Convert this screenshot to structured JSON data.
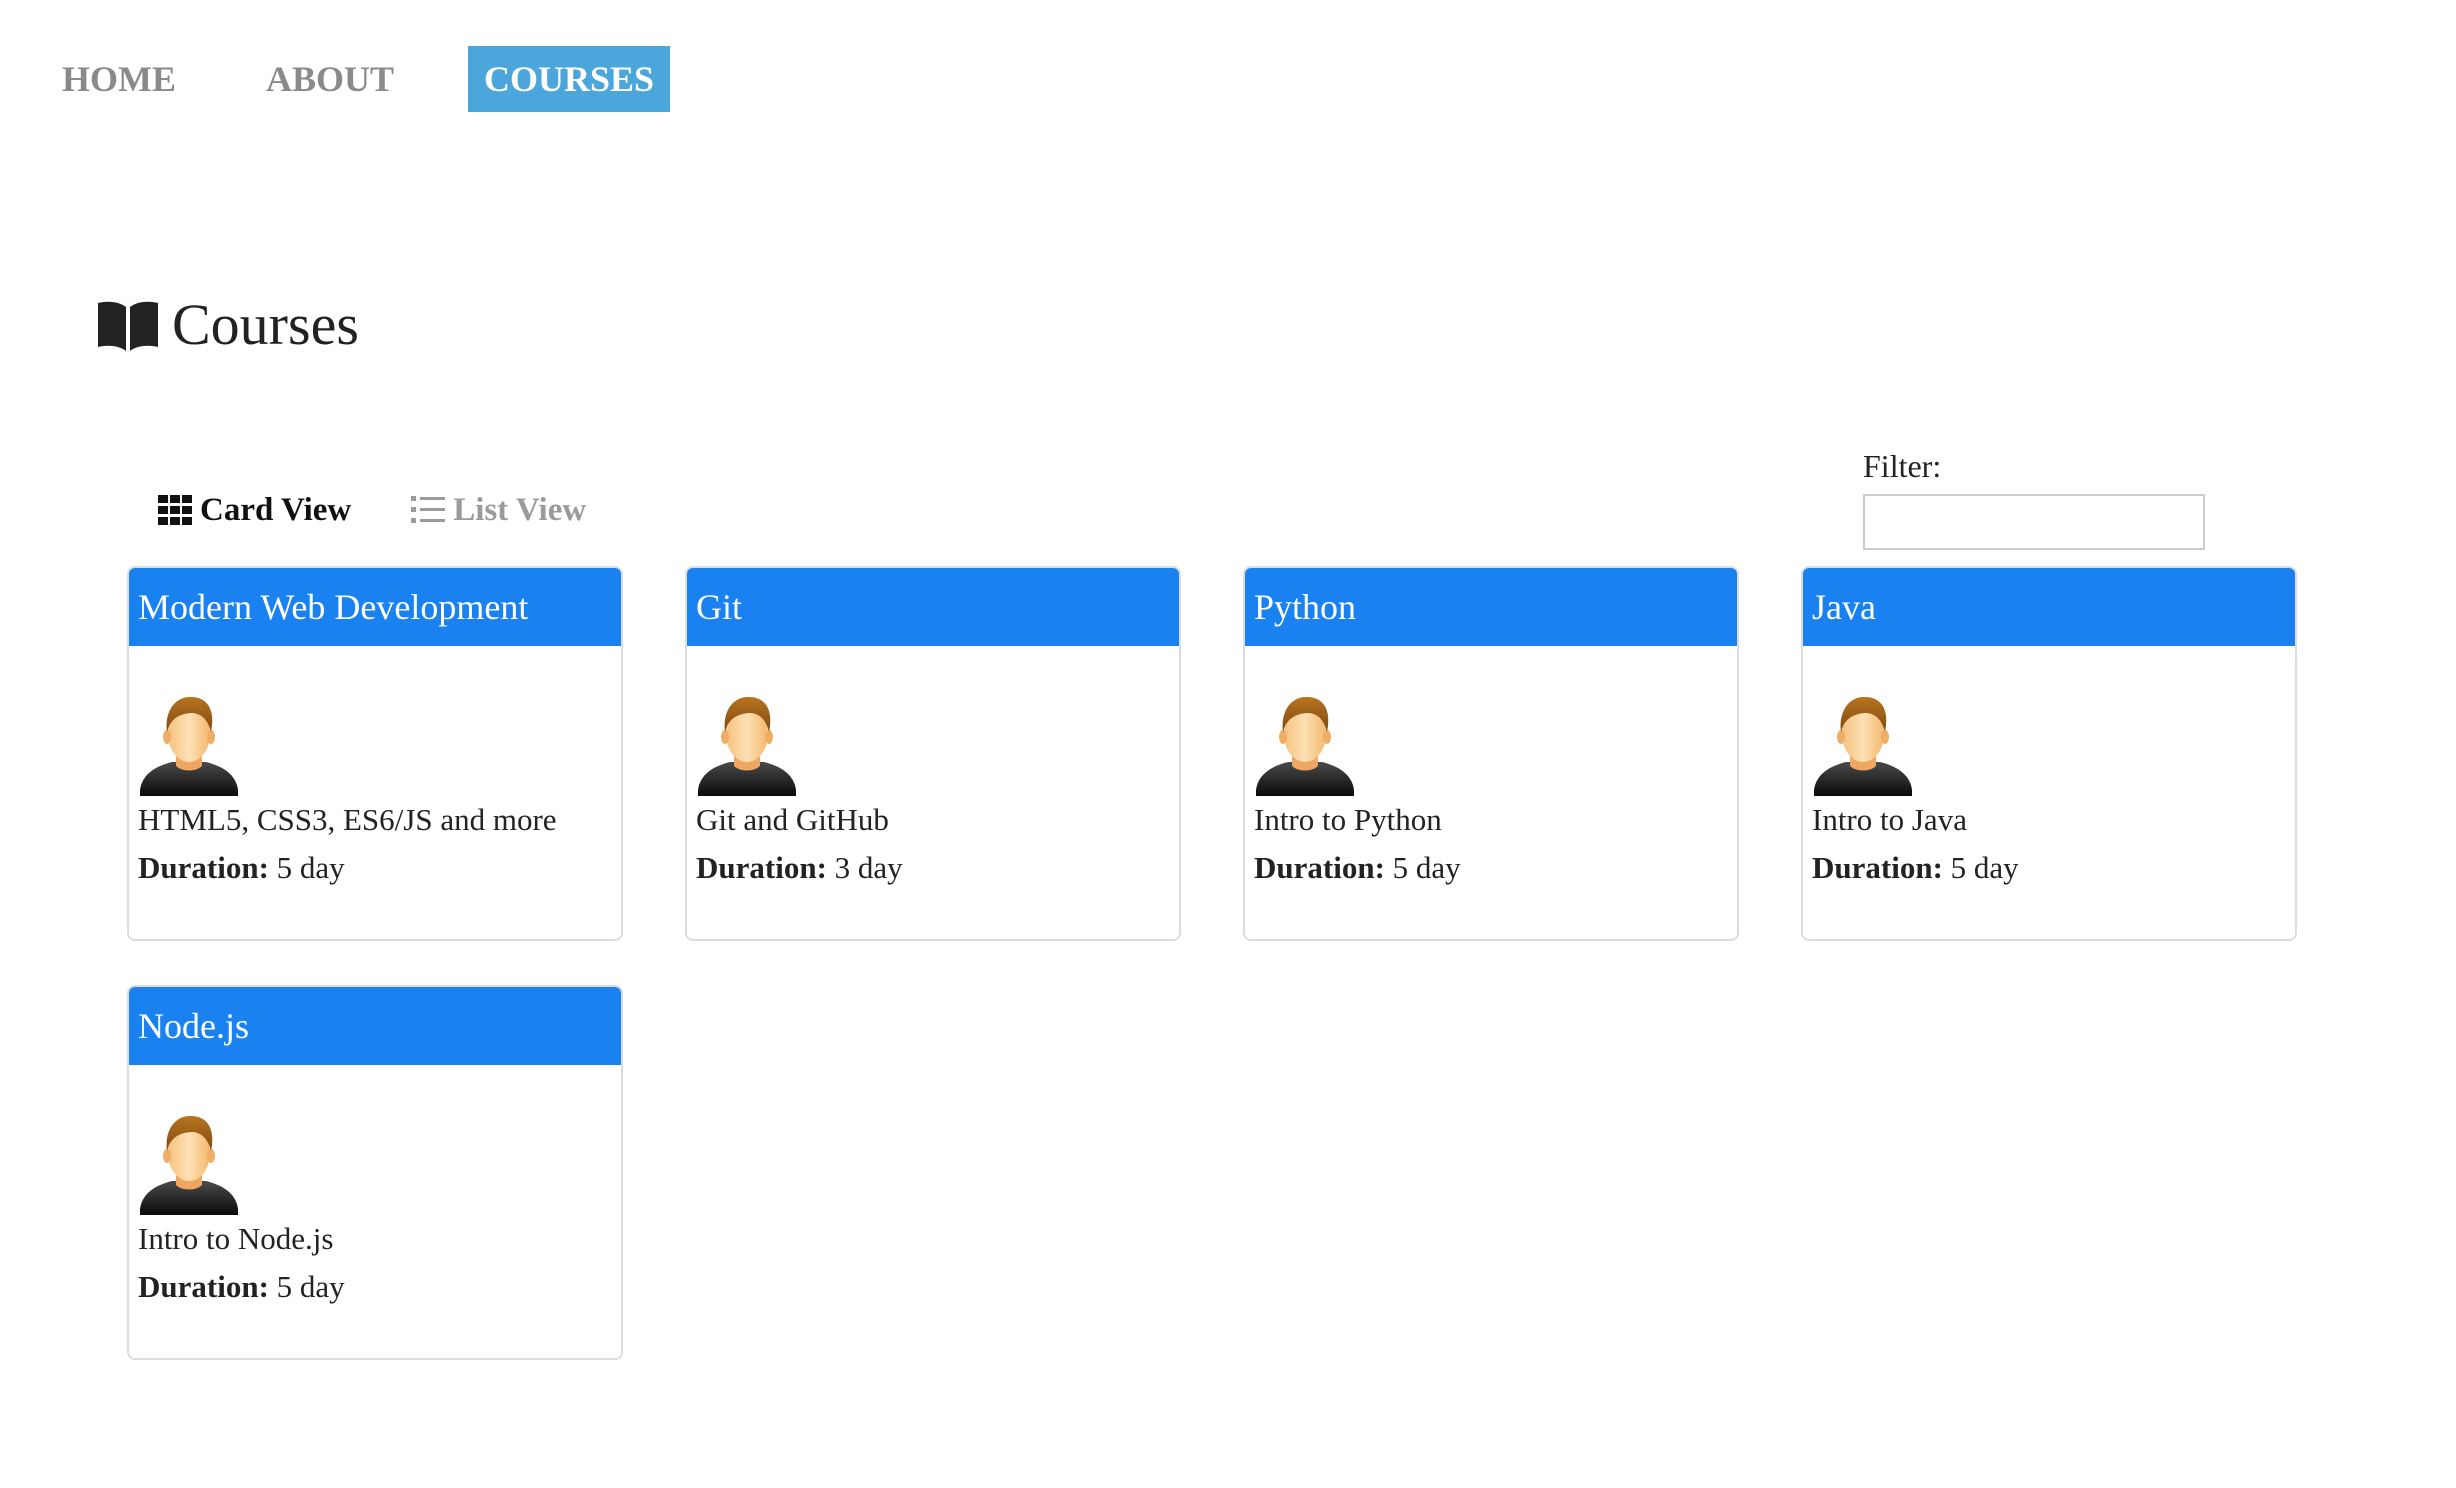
{
  "nav": {
    "items": [
      {
        "label": "HOME"
      },
      {
        "label": "ABOUT"
      },
      {
        "label": "COURSES"
      }
    ]
  },
  "page": {
    "title": "Courses",
    "icon": "book-icon"
  },
  "view_toggle": {
    "card_label": "Card View",
    "list_label": "List View",
    "active": "Card View"
  },
  "filter": {
    "label": "Filter:",
    "value": "",
    "placeholder": ""
  },
  "colors": {
    "nav_active_bg": "#4ba6dc",
    "card_header_bg": "#1a82f0",
    "nav_inactive_text": "#8a8a8a"
  },
  "courses": [
    {
      "title": "Modern Web Development",
      "description": "HTML5, CSS3, ES6/JS and more",
      "duration_label": "Duration:",
      "duration": "5 day"
    },
    {
      "title": "Git",
      "description": "Git and GitHub",
      "duration_label": "Duration:",
      "duration": "3 day"
    },
    {
      "title": "Python",
      "description": "Intro to Python",
      "duration_label": "Duration:",
      "duration": "5 day"
    },
    {
      "title": "Java",
      "description": "Intro to Java",
      "duration_label": "Duration:",
      "duration": "5 day"
    },
    {
      "title": "Node.js",
      "description": "Intro to Node.js",
      "duration_label": "Duration:",
      "duration": "5 day"
    }
  ]
}
